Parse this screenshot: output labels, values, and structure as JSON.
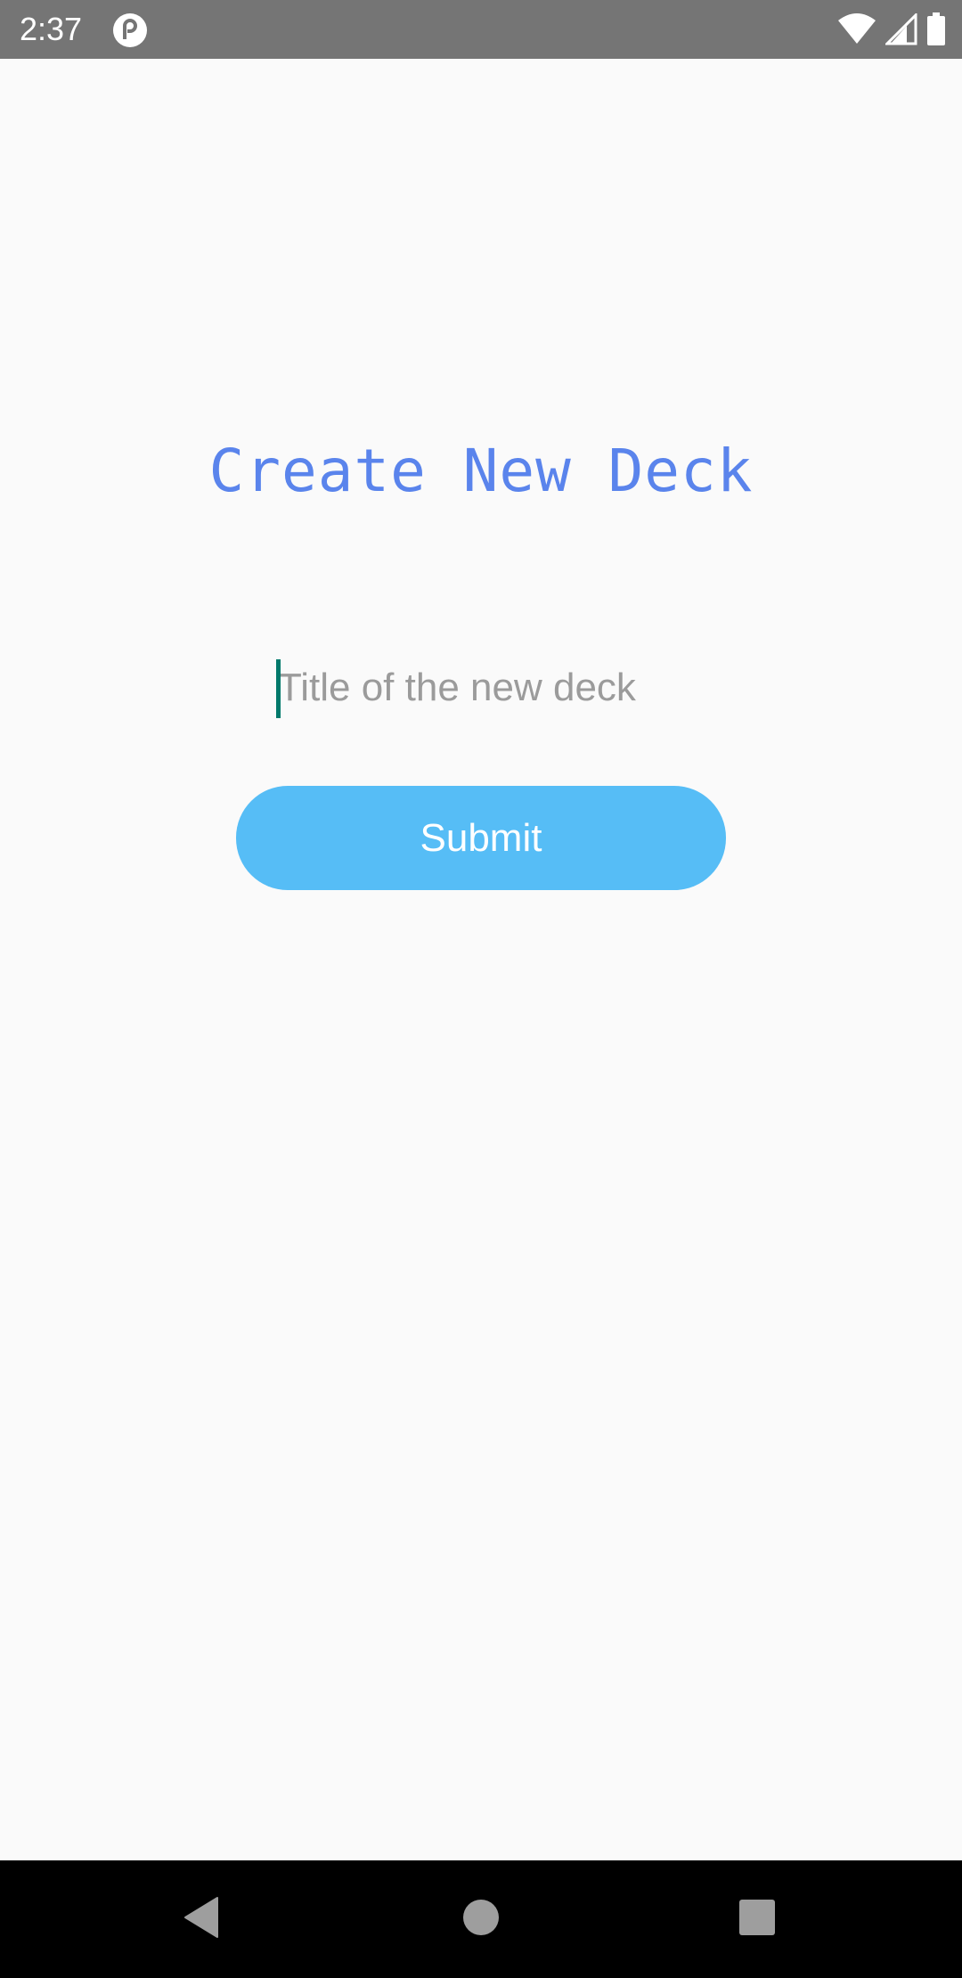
{
  "status_bar": {
    "time": "2:37",
    "app_icon": "pocket-casts-icon",
    "icons": [
      "wifi-icon",
      "cell-signal-icon",
      "battery-icon"
    ],
    "background": "#757575"
  },
  "page": {
    "title": "Create New Deck",
    "title_color": "#5a84ec",
    "background": "#fafafa"
  },
  "form": {
    "title_input": {
      "placeholder": "Title of the new deck",
      "value": ""
    },
    "submit_label": "Submit",
    "submit_color": "#56bdf6",
    "cursor_color": "#00796b"
  },
  "nav_bar": {
    "icons": [
      "back-icon",
      "home-icon",
      "recents-icon"
    ],
    "background": "#000000"
  }
}
